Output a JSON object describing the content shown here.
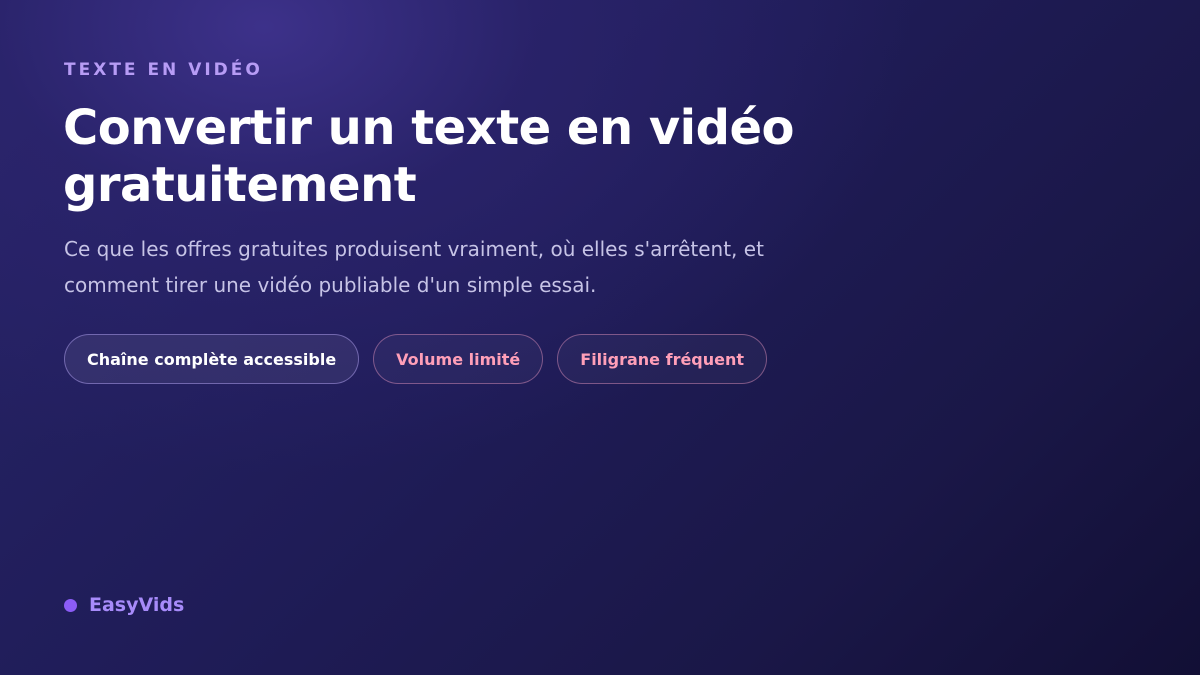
{
  "hero": {
    "eyebrow": "TEXTE EN VIDÉO",
    "title": "Convertir un texte en vidéo gratuitement",
    "subtitle": "Ce que les offres gratuites produisent vraiment, où elles s'arrêtent, et comment tirer une vidéo publiable d'un simple essai."
  },
  "tags": [
    {
      "label": "Chaîne complète accessible",
      "color": "#ffffff"
    },
    {
      "label": "Volume limité",
      "color": "#ff9fb8"
    },
    {
      "label": "Filigrane fréquent",
      "color": "#ff9fb8"
    }
  ],
  "brand": {
    "name": "EasyVids",
    "dot_color": "#8b5cf6"
  },
  "colors": {
    "eyebrow": "#b79cf5",
    "background": "#1f1c57"
  }
}
